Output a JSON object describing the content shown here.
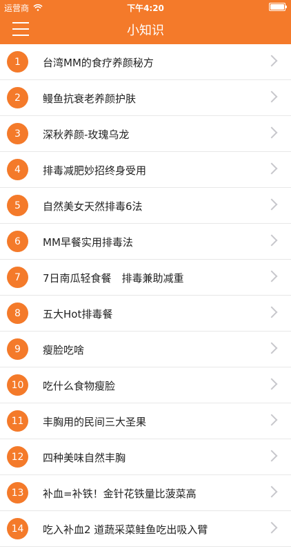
{
  "status": {
    "carrier": "运营商",
    "time": "下午4:20"
  },
  "nav": {
    "title": "小知识"
  },
  "items": [
    {
      "number": "1",
      "label": "台湾MM的食疗养颜秘方"
    },
    {
      "number": "2",
      "label": "鳗鱼抗衰老养颜护肤"
    },
    {
      "number": "3",
      "label": "深秋养颜-玫瑰乌龙"
    },
    {
      "number": "4",
      "label": "排毒减肥妙招终身受用"
    },
    {
      "number": "5",
      "label": "自然美女天然排毒6法"
    },
    {
      "number": "6",
      "label": "MM早餐实用排毒法"
    },
    {
      "number": "7",
      "label": "7日南瓜轻食餐　排毒兼助减重"
    },
    {
      "number": "8",
      "label": "五大Hot排毒餐"
    },
    {
      "number": "9",
      "label": "瘦脸吃啥"
    },
    {
      "number": "10",
      "label": "吃什么食物瘦脸"
    },
    {
      "number": "11",
      "label": "丰胸用的民间三大圣果"
    },
    {
      "number": "12",
      "label": "四种美味自然丰胸"
    },
    {
      "number": "13",
      "label": "补血=补铁！金针花铁量比菠菜高"
    },
    {
      "number": "14",
      "label": "吃入补血2 道蔬采菜鲑鱼吃出吸入臂"
    }
  ],
  "colors": {
    "accent": "#f47a2a",
    "separator": "#e7e7e7"
  }
}
